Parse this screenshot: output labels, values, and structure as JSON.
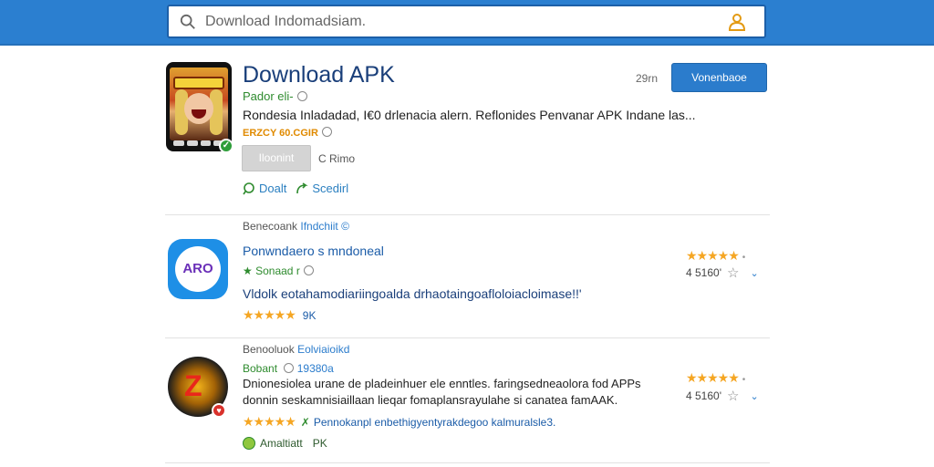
{
  "search": {
    "placeholder": "Download Indomadsiam.",
    "icon": "search-icon",
    "user_icon": "user-icon",
    "accent": "#2b7fd0"
  },
  "featured": {
    "title": "Download APK",
    "developer": "Pador eli-",
    "description": "Rondesia Inladadad, I€0 drlenacia alern. Reflonides Penvanar APK Indane las...",
    "meta": "ERZCY 60.CGIR",
    "install_label": "Iloonint",
    "size": "C Rimo",
    "action1": "Doalt",
    "action2": "Scedirl",
    "count": "29rn",
    "download_label": "Vonenbaoe"
  },
  "section1": {
    "label_prefix": "Benecoank",
    "label_highlight": "Ifndchiit ©"
  },
  "item1": {
    "icon_text": "ARO",
    "title": "Ponwndaero s mndoneal",
    "developer": "Sonaad r",
    "description": "Vldolk eotahamodiariingoalda drhaotaingoafloloiacloimase!!'",
    "rating_count": "9K",
    "side_rating_dots": "•",
    "side_count": "4 5160'",
    "rating": 4.5
  },
  "section2": {
    "label_prefix": "Benooluok",
    "label_highlight": "Eolviaioikd"
  },
  "item2": {
    "developer": "Bobant",
    "developer_meta": "19380a",
    "desc_line1": "Dnionesiolea urane de pladeinhuer ele enntles. faringsedneaolora fod APPs",
    "desc_line2": "donnin seskamnisiaillaan lieqar fomaplansrayulahe si canatea famAAK.",
    "tag_text": "Pennokanpl enbethigyentyrakdegoo kalmuralsle3.",
    "footer": "Amaltiatt",
    "footer_suffix": "PK",
    "side_rating_dots": "•",
    "side_count": "4 5160'",
    "rating": 4.5
  }
}
